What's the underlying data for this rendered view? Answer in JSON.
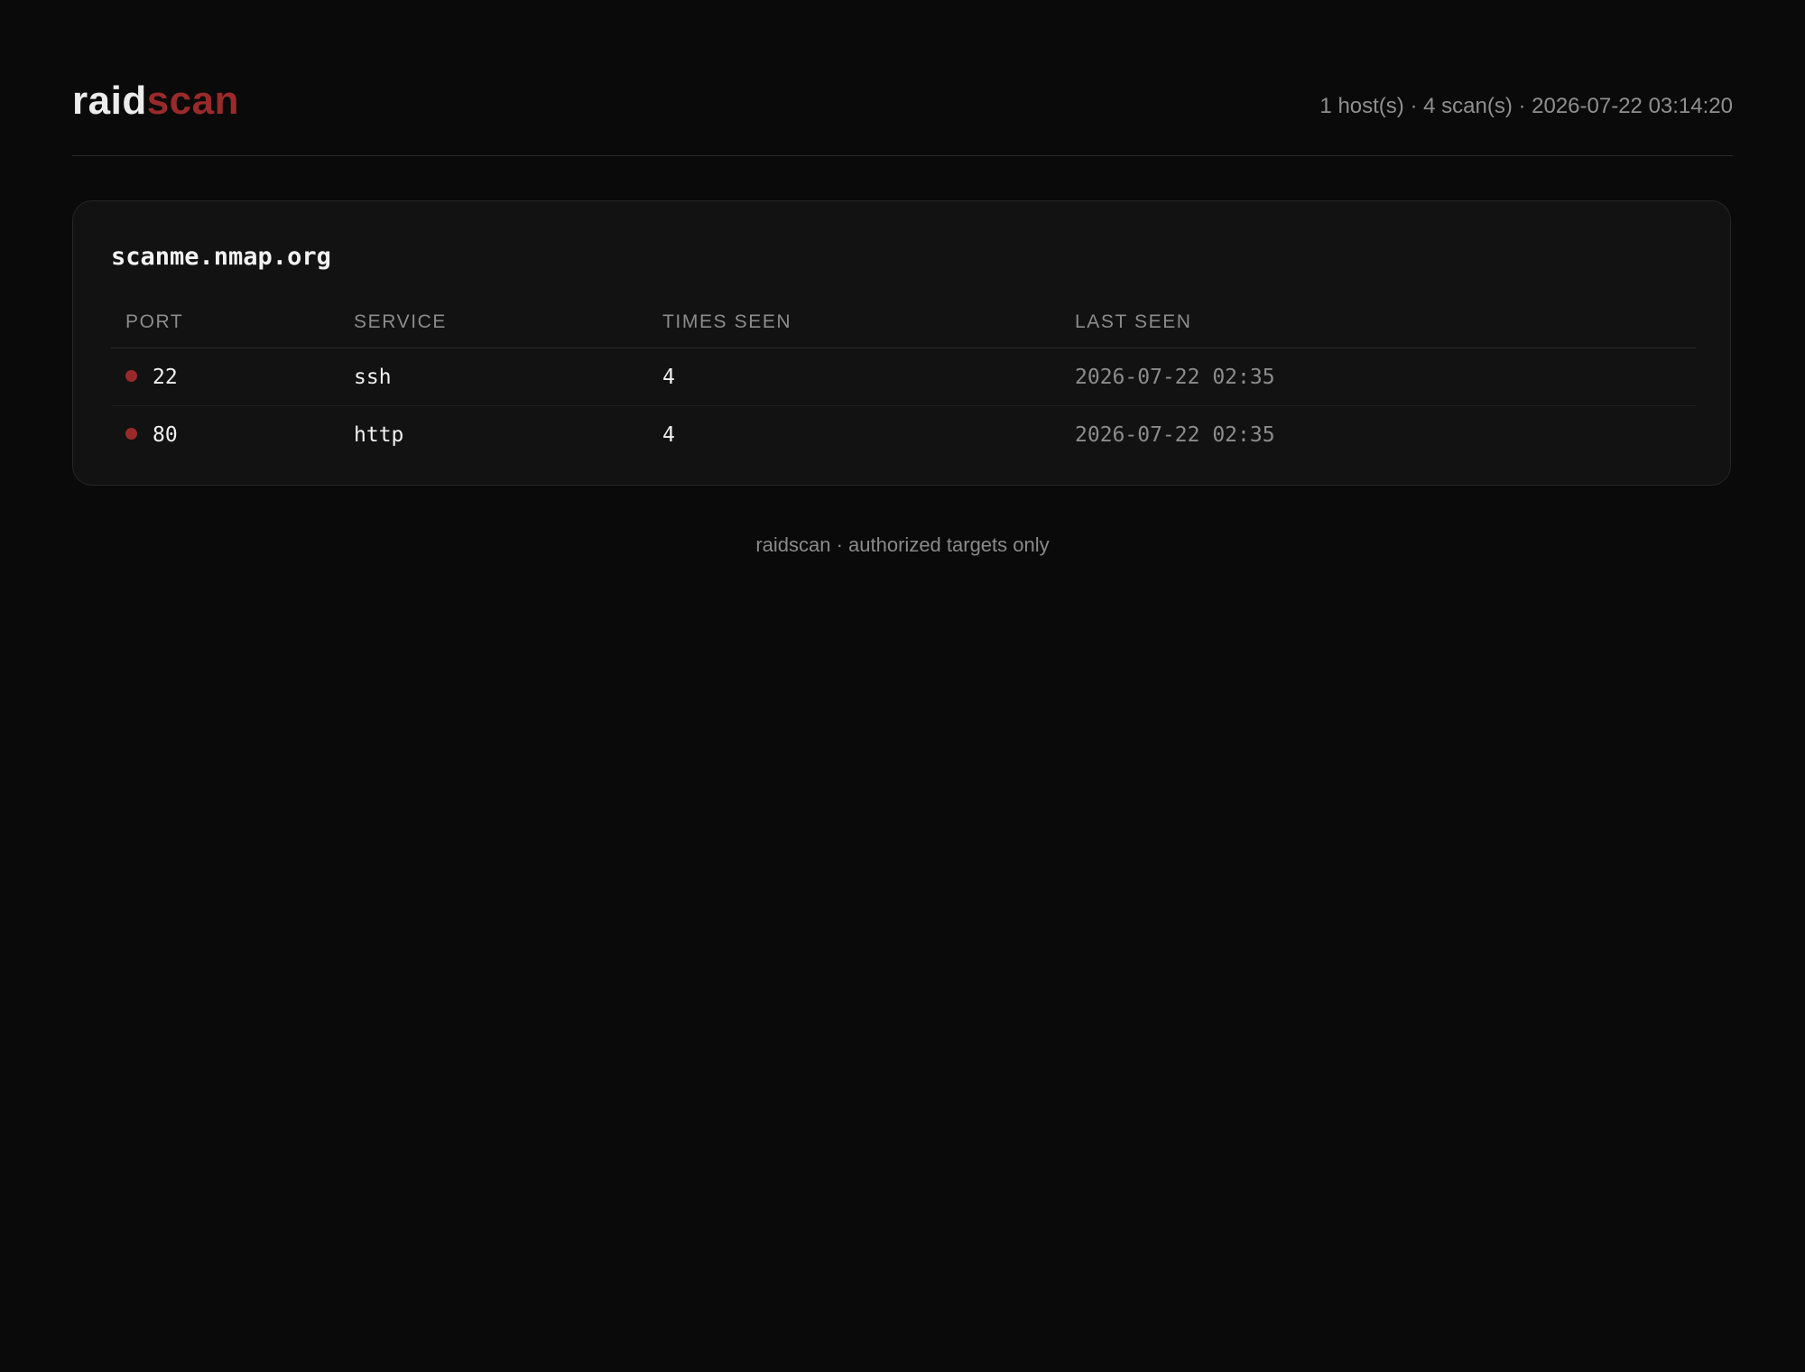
{
  "header": {
    "brand_part1": "raid",
    "brand_part2": "scan",
    "meta": "1 host(s) · 4 scan(s) · 2026-07-22 03:14:20"
  },
  "host": {
    "name": "scanme.nmap.org",
    "columns": [
      "PORT",
      "SERVICE",
      "TIMES SEEN",
      "LAST SEEN"
    ],
    "rows": [
      {
        "port": "22",
        "service": "ssh",
        "times_seen": "4",
        "last_seen": "2026-07-22 02:35"
      },
      {
        "port": "80",
        "service": "http",
        "times_seen": "4",
        "last_seen": "2026-07-22 02:35"
      }
    ]
  },
  "footer": {
    "text": "raidscan · authorized targets only"
  },
  "colors": {
    "background": "#0a0a0a",
    "card": "#121212",
    "accent": "#9a2a2a",
    "muted_text": "#8c8c8c"
  },
  "icons": {
    "port_status": "open-port-status-dot"
  }
}
